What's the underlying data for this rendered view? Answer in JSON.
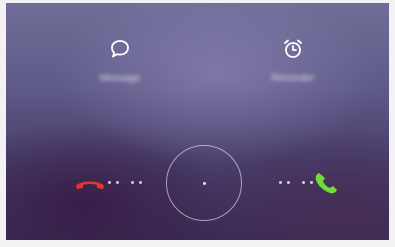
{
  "incoming_call": {
    "quick_actions": [
      {
        "label": "Message",
        "icon": "message-bubble-icon"
      },
      {
        "label": "Reminder",
        "icon": "alarm-clock-icon"
      }
    ],
    "decline": {
      "icon": "phone-hangup-icon",
      "color": "#e8352b"
    },
    "answer": {
      "icon": "phone-answer-icon",
      "color": "#6fdc3c"
    },
    "slider": {
      "icon": "slider-ring"
    }
  }
}
